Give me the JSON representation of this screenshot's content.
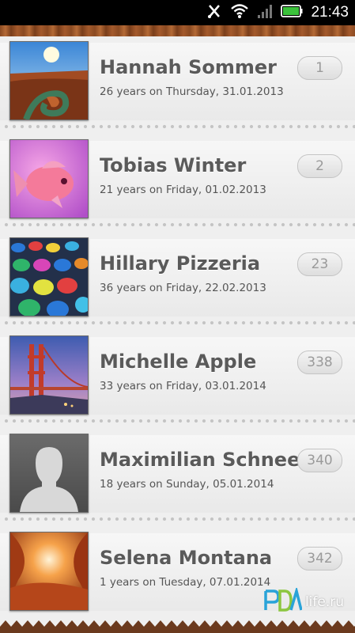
{
  "status_bar": {
    "time": "21:43",
    "icons": [
      "vibrate-icon",
      "wifi-icon",
      "signal-icon",
      "battery-icon"
    ]
  },
  "contacts": [
    {
      "name": "Hannah Sommer",
      "detail": "26 years on Thursday, 31.01.2013",
      "days": "1",
      "image": "canyon-photo"
    },
    {
      "name": "Tobias Winter",
      "detail": "21 years on Friday, 01.02.2013",
      "days": "2",
      "image": "pink-fish-photo"
    },
    {
      "name": "Hillary Pizzeria",
      "detail": "36 years on Friday, 22.02.2013",
      "days": "23",
      "image": "colorful-spheres-photo"
    },
    {
      "name": "Michelle Apple",
      "detail": "33 years on Friday, 03.01.2014",
      "days": "338",
      "image": "golden-gate-bridge-photo"
    },
    {
      "name": "Maximilian Schnee",
      "detail": "18 years on Sunday, 05.01.2014",
      "days": "340",
      "image": "default-avatar"
    },
    {
      "name": "Selena Montana",
      "detail": "1 years on Tuesday, 07.01.2014",
      "days": "342",
      "image": "antelope-canyon-photo"
    }
  ],
  "watermark": {
    "text": "life.ru"
  },
  "colors": {
    "paper": "#efefef",
    "wood": "#8a4a22",
    "badge_text": "#9a9a9a",
    "name_text": "#5a5a5a"
  }
}
